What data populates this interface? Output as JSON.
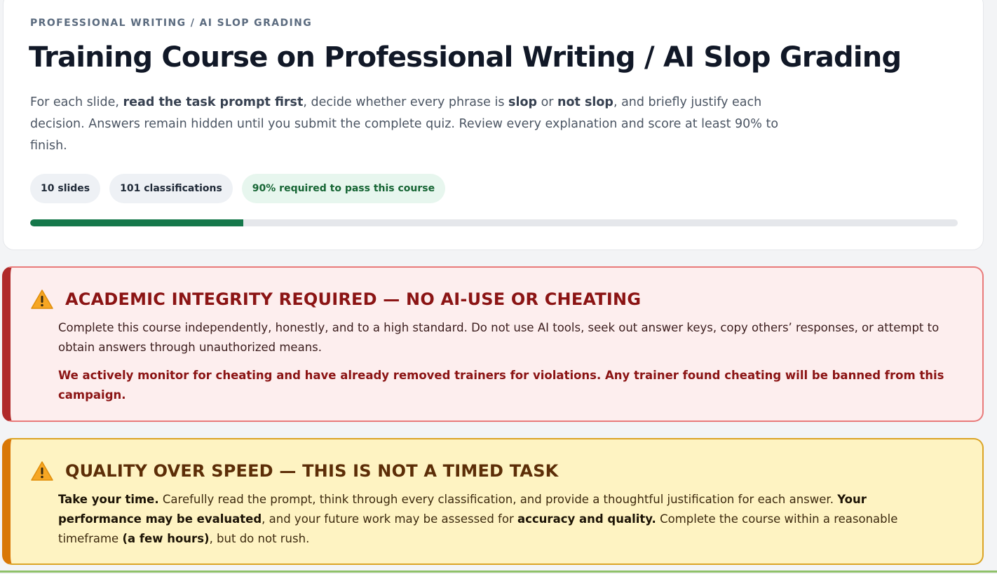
{
  "header": {
    "eyebrow": "PROFESSIONAL WRITING / AI SLOP GRADING",
    "title": "Training Course on Professional Writing / AI Slop Grading",
    "intro": {
      "p1": "For each slide, ",
      "b1": "read the task prompt first",
      "p2": ", decide whether every phrase is ",
      "b2": "slop",
      "p3": " or ",
      "b3": "not slop",
      "p4": ", and briefly justify each decision. Answers remain hidden until you submit the complete quiz. Review every explanation and score at least 90% to finish."
    },
    "pills": {
      "slides": "10 slides",
      "classifications": "101 classifications",
      "pass": "90% required to pass this course"
    },
    "progress": {
      "fraction": 0.23,
      "fill_color": "#15784b"
    }
  },
  "integrity": {
    "icon": "warning-icon",
    "title": "ACADEMIC INTEGRITY REQUIRED — NO AI-USE OR CHEATING",
    "body1": "Complete this course independently, honestly, and to a high standard. Do not use AI tools, seek out answer keys, copy others’ responses, or attempt to obtain answers through unauthorized means.",
    "body2": "We actively monitor for cheating and have already removed trainers for violations. Any trainer found cheating will be banned from this campaign."
  },
  "quality": {
    "icon": "warning-icon",
    "title": "QUALITY OVER SPEED — THIS IS NOT A TIMED TASK",
    "b1": "Take your time.",
    "p1": " Carefully read the prompt, think through every classification, and provide a thoughtful justification for each answer. ",
    "b2": "Your performance may be evaluated",
    "p2": ", and your future work may be assessed for ",
    "b3": "accuracy and quality.",
    "p3": " Complete the course within a reasonable timeframe ",
    "b4": "(a few hours)",
    "p4": ", but do not rush."
  },
  "colors": {
    "accent_green": "#15784b",
    "danger": "#b02a2a",
    "warning": "#d97706"
  }
}
